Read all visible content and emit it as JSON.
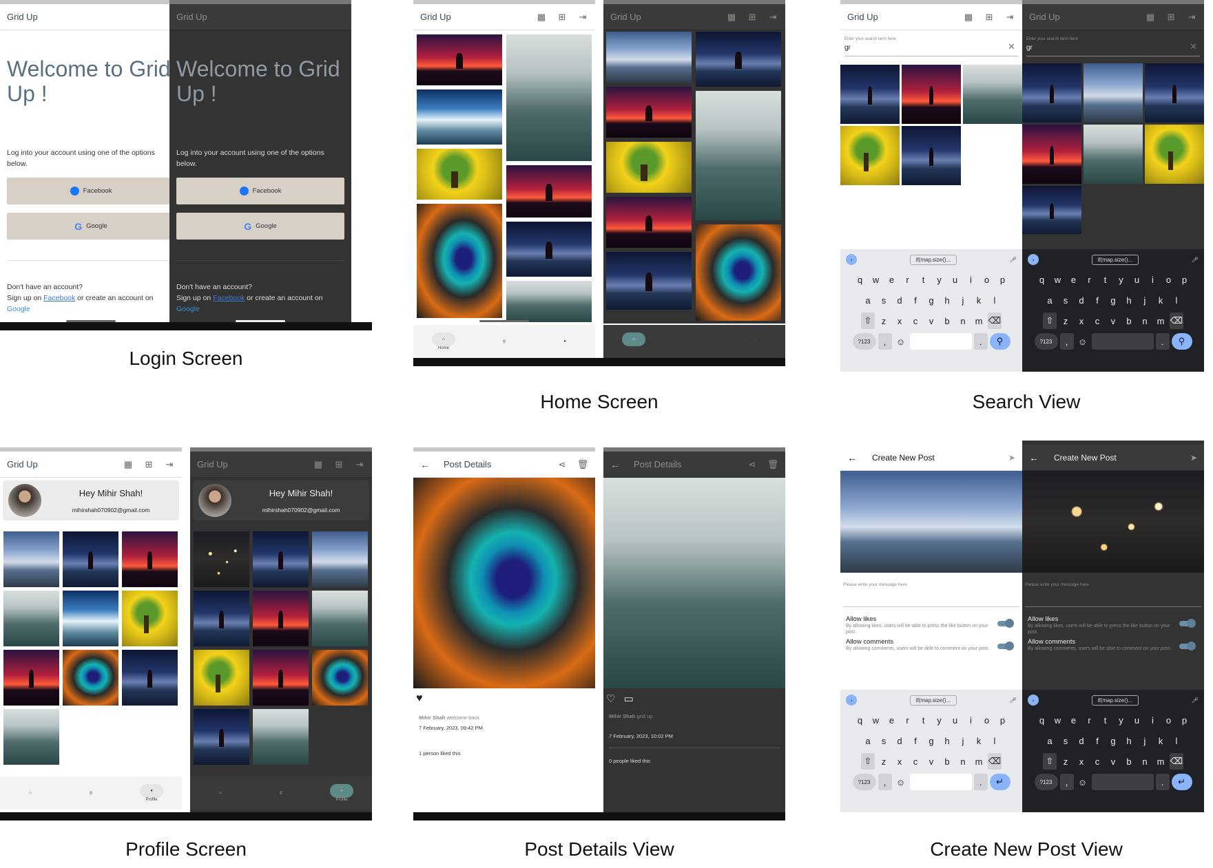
{
  "app": {
    "name": "Grid Up"
  },
  "captions": {
    "login": "Login Screen",
    "home": "Home Screen",
    "search": "Search View",
    "profile": "Profile Screen",
    "post": "Post Details View",
    "create": "Create New Post View"
  },
  "login": {
    "welcome": "Welcome to Grid Up !",
    "subtitle": "Log into your account using one of the options below.",
    "facebook": "Facebook",
    "google": "Google",
    "no_account": "Don't have an account?",
    "signup_prefix": "Sign up on ",
    "signup_fb": "Facebook",
    "signup_mid": " or create an account on ",
    "signup_google": "Google"
  },
  "nav": {
    "home": "Home",
    "profile": "Profile"
  },
  "search": {
    "placeholder": "Enter your search term here",
    "value": "gr"
  },
  "keyboard": {
    "suggestion": "if(map.size()...",
    "row1": [
      "q",
      "w",
      "e",
      "r",
      "t",
      "y",
      "u",
      "i",
      "o",
      "p"
    ],
    "row2": [
      "a",
      "s",
      "d",
      "f",
      "g",
      "h",
      "j",
      "k",
      "l"
    ],
    "row3": [
      "z",
      "x",
      "c",
      "v",
      "b",
      "n",
      "m"
    ],
    "sym": "?123"
  },
  "profile": {
    "greeting": "Hey Mihir Shah!",
    "email": "mihirshah070902@gmail.com"
  },
  "post_light": {
    "title": "Post Details",
    "author": "Mihir Shah",
    "caption": "welcome back",
    "date": "7 February, 2023, 09:42 PM",
    "likes": "1 person liked this"
  },
  "post_dark": {
    "title": "Post Details",
    "author": "Mihir Shah",
    "caption": "grid up",
    "date": "7 February, 2023, 10:02 PM",
    "likes": "0 people liked this"
  },
  "create": {
    "title": "Create New Post",
    "message_placeholder": "Please write your message here",
    "allow_likes": "Allow likes",
    "allow_likes_desc": "By allowing likes, users will be able to press the like button on your post.",
    "allow_comments": "Allow comments",
    "allow_comments_desc": "By allowing comments, users will be able to comment on your post.",
    "likes_enabled": true,
    "comments_enabled": true
  }
}
